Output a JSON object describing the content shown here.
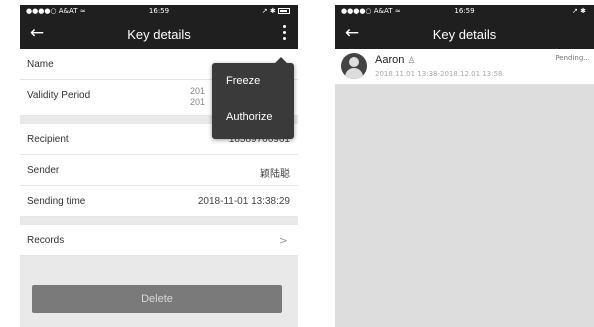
{
  "left_screen": {
    "status": {
      "carrier": "●●●●○ A&AT",
      "wifi": "≈",
      "time": "16:59",
      "right": "↗ ✱"
    },
    "nav": {
      "title": "Key details",
      "back_icon": "←"
    },
    "menu": {
      "items": [
        "Freeze",
        "Authorize"
      ]
    },
    "rows": {
      "name_label": "Name",
      "validity_label": "Validity Period",
      "validity_value_line1": "201",
      "validity_value_line2": "201",
      "recipient_label": "Recipient",
      "recipient_value": "18589706961",
      "sender_label": "Sender",
      "sender_value": "颖陆聪",
      "sending_time_label": "Sending time",
      "sending_time_value": "2018-11-01 13:38:29",
      "records_label": "Records",
      "records_chevron": ">"
    },
    "delete_label": "Delete"
  },
  "right_screen": {
    "status": {
      "carrier": "●●●●○ A&AT",
      "wifi": "≈",
      "time": "16:59",
      "right": "↗ ✱"
    },
    "nav": {
      "title": "Key details",
      "back_icon": "←"
    },
    "list": [
      {
        "name": "Aaron",
        "icon": "♙",
        "period": "2018.11.01 13:38-2018.12.01 13:58",
        "status": "Pending..."
      }
    ]
  },
  "colors": {
    "header": "#1f1f1f",
    "popup": "#3a3a3a",
    "delete_button": "#7a7a7a",
    "background": "#e9e9e9"
  }
}
